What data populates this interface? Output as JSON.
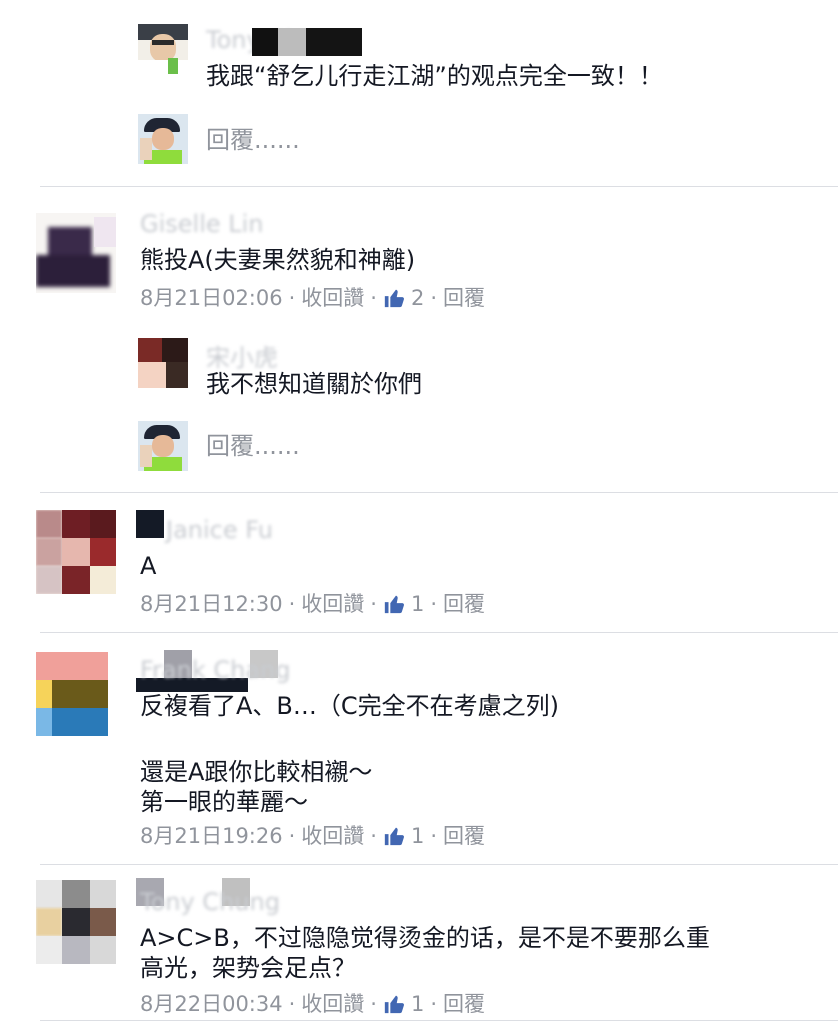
{
  "replies": [
    {
      "name": "Tony Chung",
      "text": "我跟“舒乞儿行走江湖”的观点完全一致！！"
    },
    {
      "name": "宋小虎",
      "text": "我不想知道關於你們"
    }
  ],
  "reply_prompt": "回覆......",
  "comments": [
    {
      "name": "Giselle Lin",
      "text": "熊投A(夫妻果然貌和神離)",
      "time": "8月21日02:06",
      "like_count": "2"
    },
    {
      "name": "Janice Fu",
      "text": "A",
      "time": "8月21日12:30",
      "like_count": "1"
    },
    {
      "name": "Frank Chang",
      "text_line1": "反複看了A、B…（C完全不在考慮之列)",
      "text_line2": "還是A跟你比較相襯～",
      "text_line3": "第一眼的華麗～",
      "time": "8月21日19:26",
      "like_count": "1"
    },
    {
      "name": "Tony Chung",
      "text_line1": "A>C>B，不过隐隐觉得烫金的话，是不是不要那么重",
      "text_line2": "高光，架势会足点？",
      "time": "8月22日00:34",
      "like_count": "1"
    }
  ],
  "actions": {
    "unlike": "收回讚",
    "reply": "回覆",
    "separator": "·"
  },
  "icons": {
    "like": "thumbs-up-icon"
  },
  "colors": {
    "like_blue": "#4267b2",
    "meta_gray": "#90949c",
    "divider": "#dcdee3"
  }
}
